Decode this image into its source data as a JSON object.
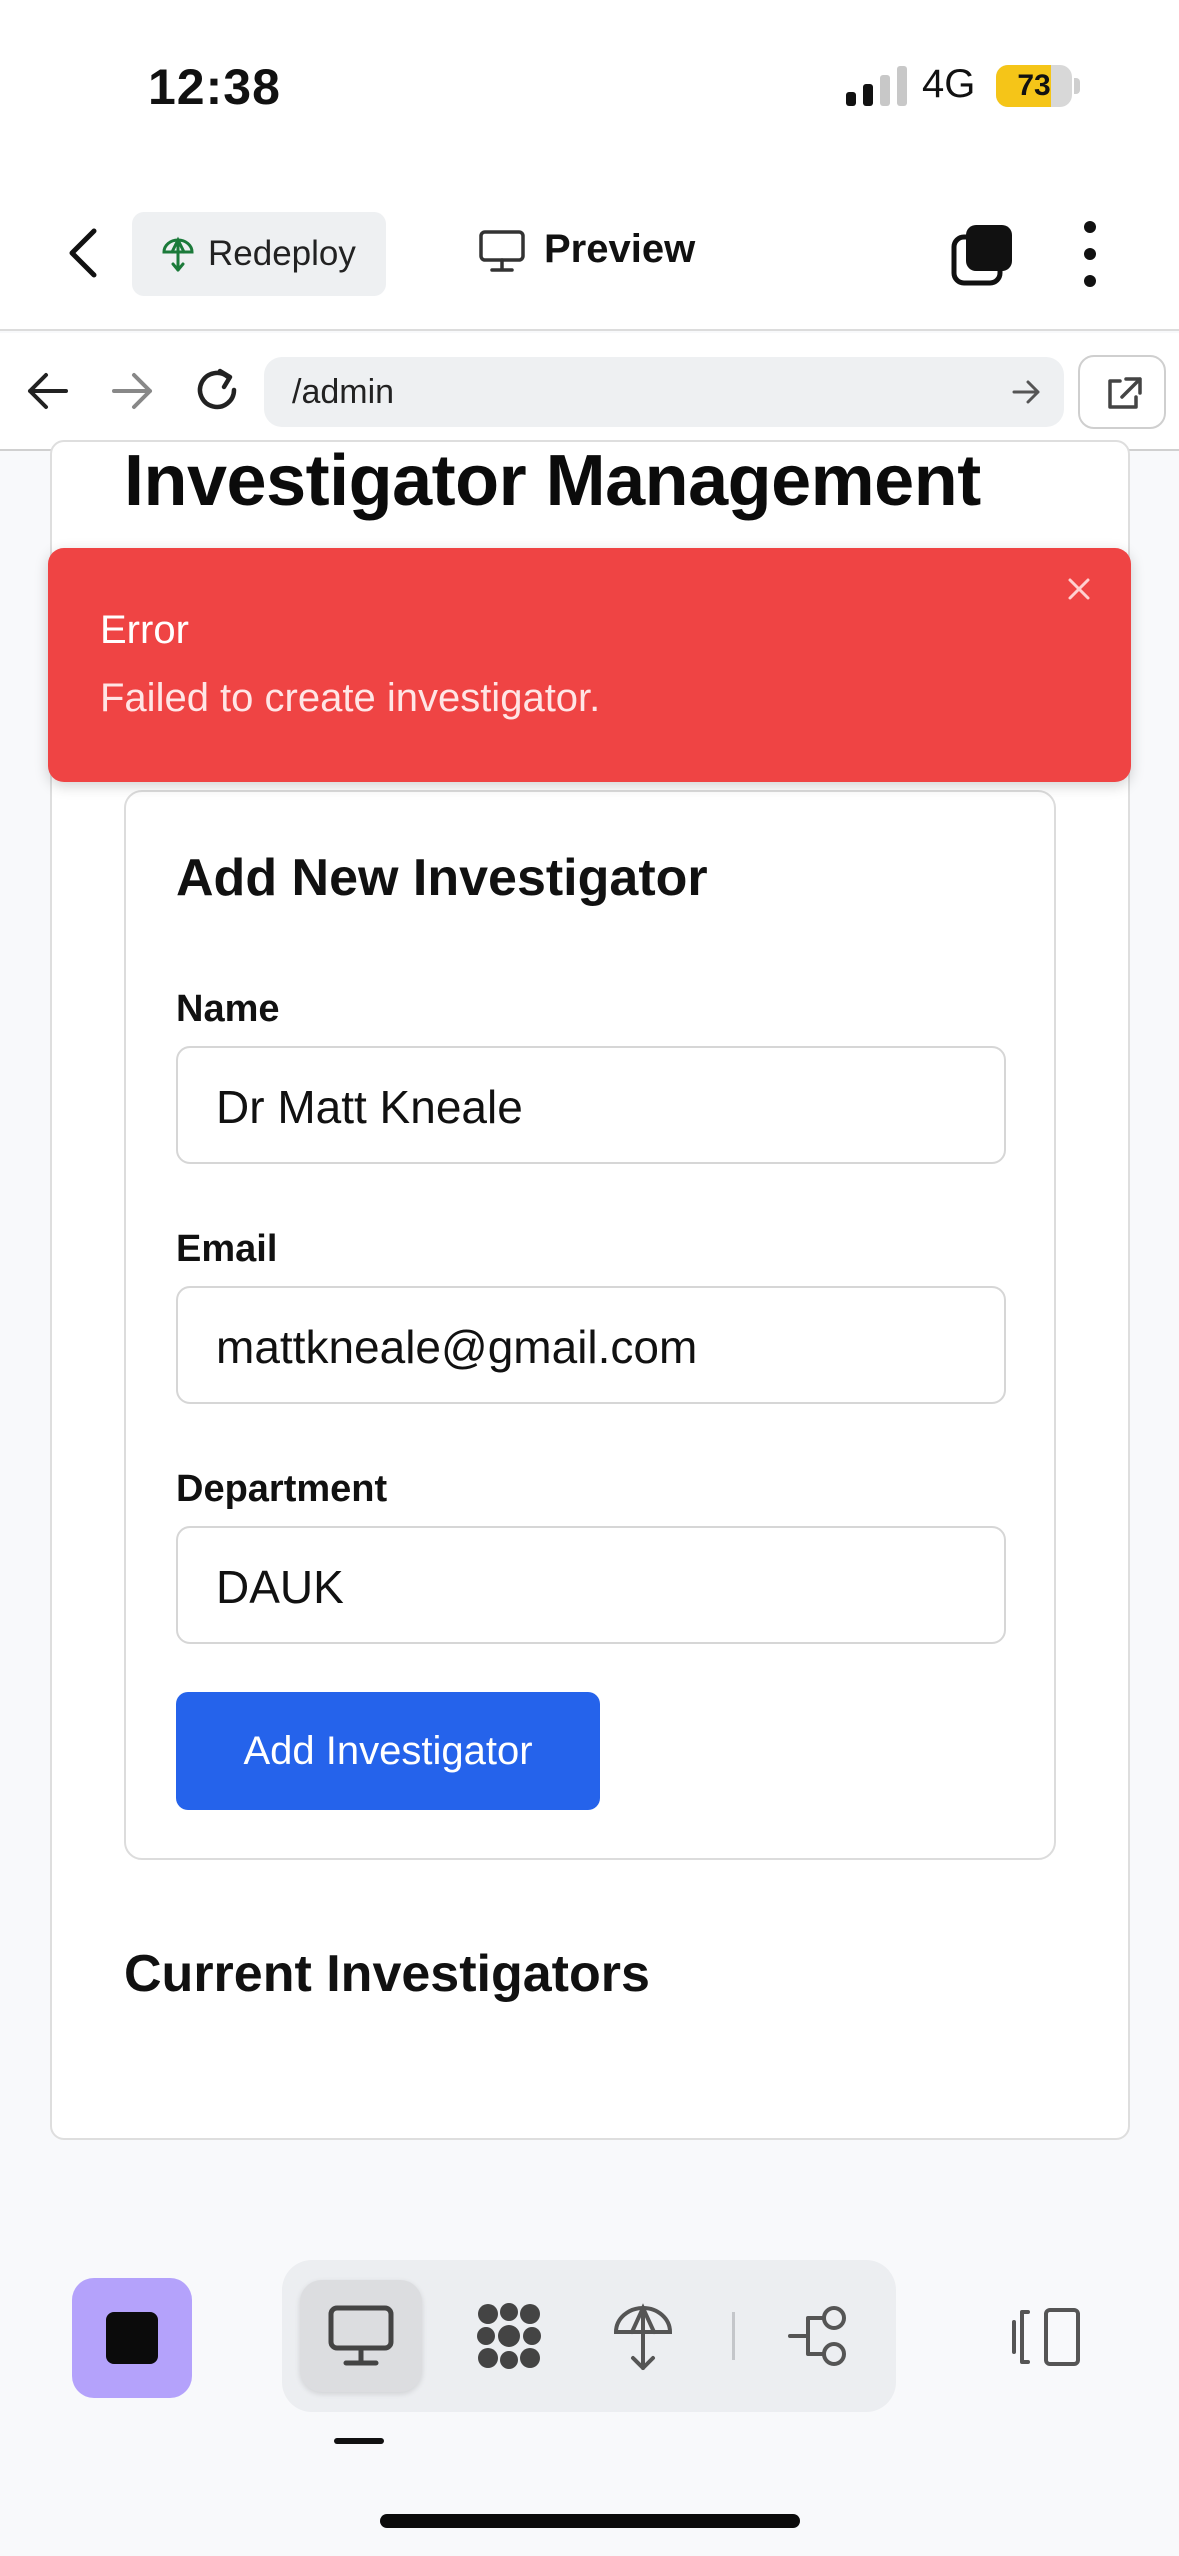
{
  "status_bar": {
    "time": "12:38",
    "network": "4G",
    "battery_percent": 73,
    "battery_label": "73",
    "battery_color": "#f5c518"
  },
  "toolbar": {
    "back_icon": "chevron-left-icon",
    "redeploy_label": "Redeploy",
    "redeploy_icon": "deploy-icon",
    "preview_label": "Preview",
    "preview_icon": "monitor-icon",
    "tabs_icon": "tabs-icon",
    "more_icon": "kebab-menu-icon"
  },
  "browser": {
    "url": "/admin"
  },
  "page": {
    "title": "Investigator Management",
    "form": {
      "title": "Add New Investigator",
      "fields": [
        {
          "label": "Name",
          "value": "Dr Matt Kneale"
        },
        {
          "label": "Email",
          "value": "mattkneale@gmail.com"
        },
        {
          "label": "Department",
          "value": "DAUK"
        }
      ],
      "submit_label": "Add Investigator",
      "submit_color": "#2563eb"
    },
    "list_title": "Current Investigators"
  },
  "toast": {
    "title": "Error",
    "message": "Failed to create investigator.",
    "color": "#ef4444"
  },
  "dock": {
    "accent": "#b4a2fb",
    "items": [
      {
        "icon": "monitor-icon",
        "active": true
      },
      {
        "icon": "cluster-icon",
        "active": false
      },
      {
        "icon": "deploy-icon",
        "active": false
      },
      {
        "icon": "workflow-icon",
        "active": false
      }
    ]
  }
}
